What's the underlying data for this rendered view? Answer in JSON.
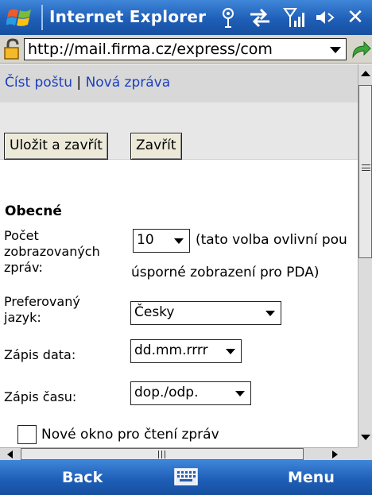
{
  "titlebar": {
    "app_title": "Internet Explorer",
    "icons": [
      "windows-flag-icon",
      "connectivity-icon",
      "data-sync-icon",
      "signal-strength-icon",
      "speaker-icon",
      "close-icon"
    ],
    "close_glyph": "✕"
  },
  "addressbar": {
    "url": "http://mail.firma.cz/express/com",
    "icons": [
      "lock-icon",
      "dropdown-arrow-icon",
      "go-arrow-icon"
    ]
  },
  "nav": {
    "read_mail": "Číst poštu",
    "separator": " | ",
    "new_message": "Nová zpráva"
  },
  "toolbar": {
    "save_close": "Uložit a zavřít",
    "close": "Zavřít"
  },
  "settings": {
    "section_title": "Obecné",
    "message_count": {
      "label_line1": "Počet",
      "label_line2": "zobrazovaných",
      "label_line3": "zpráv:",
      "value": "10",
      "note_line1": "(tato volba ovlivní pou",
      "note_line2": "úsporné zobrazení pro PDA)"
    },
    "language": {
      "label_line1": "Preferovaný",
      "label_line2": "jazyk:",
      "value": "Česky"
    },
    "date_format": {
      "label": "Zápis data:",
      "value": "dd.mm.rrrr"
    },
    "time_format": {
      "label": "Zápis času:",
      "value": "dop./odp."
    },
    "new_window": {
      "label": "Nové okno pro čtení zpráv",
      "checked": false
    }
  },
  "softkeys": {
    "left": "Back",
    "right": "Menu",
    "center_icon": "keyboard-icon"
  },
  "colors": {
    "titlebar_blue": "#1f5fb8",
    "link_blue": "#1b3fbf",
    "toolbar_gray": "#d8d8d8"
  }
}
